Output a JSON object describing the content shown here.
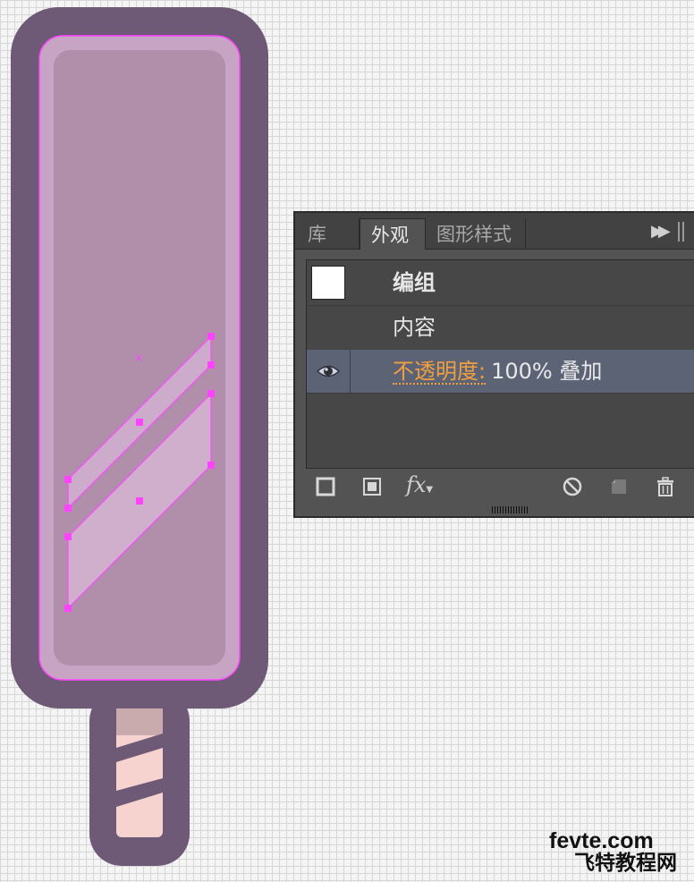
{
  "canvas": {
    "colors": {
      "outline": "#6e5a76",
      "body_light": "#c7a4c4",
      "body": "#b18fab",
      "selection": "#ff44ff",
      "stripe_fill": "#d7b6d5",
      "stick": "#f6d3cf",
      "stick_top": "#c9aaad",
      "stick_stripe": "#6e5a76"
    }
  },
  "panel": {
    "tabs": [
      "库",
      "外观",
      "图形样式"
    ],
    "active_tab": "外观",
    "menu_icon": "panel-menu-arrows",
    "rows": {
      "group_label": "编组",
      "content_label": "内容",
      "opacity_label": "不透明度:",
      "opacity_value": "100% 叠加"
    },
    "footer_icons": [
      "add-new-stroke-icon",
      "add-new-fill-icon",
      "add-new-effect-icon",
      "clear-appearance-icon",
      "duplicate-item-icon",
      "delete-item-icon"
    ],
    "fx_label": "fx"
  },
  "watermark": {
    "line1": "fevte.com",
    "line2": "飞特教程网"
  }
}
